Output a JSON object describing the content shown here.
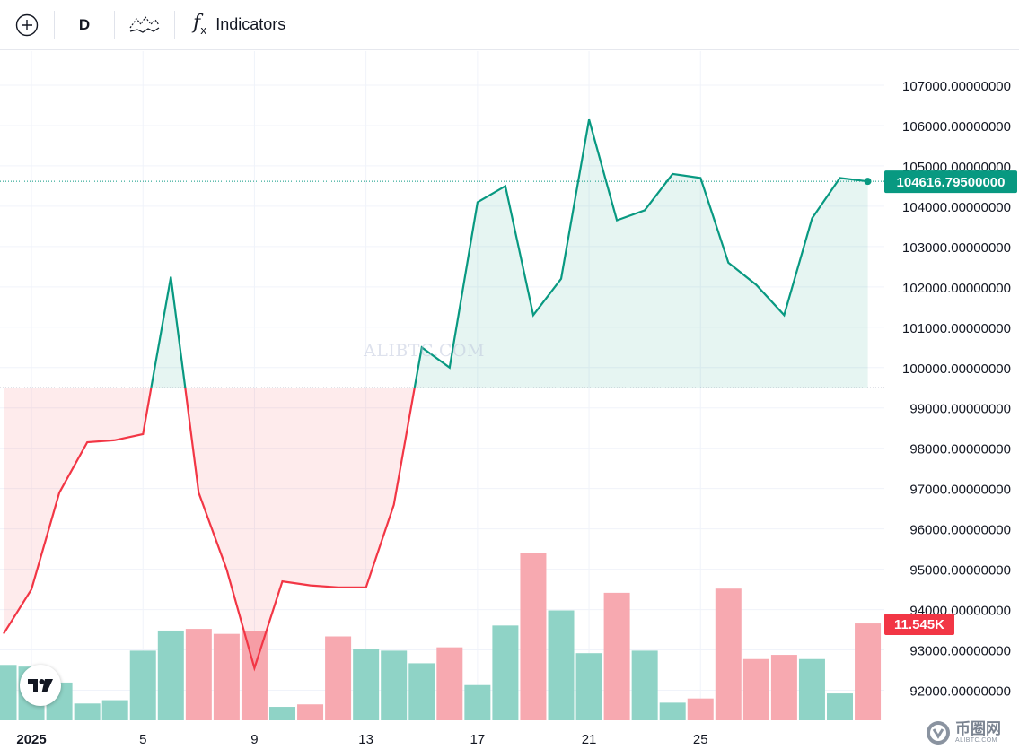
{
  "toolbar": {
    "add_icon": "plus-circle-icon",
    "interval_label": "D",
    "compare_icon": "compare-symbols-icon",
    "indicators_icon": "function-fx-icon",
    "indicators_label": "Indicators"
  },
  "watermark": "ALIBTC.COM",
  "corner_brand": {
    "main": "币圈网",
    "sub": "ALIBTC.COM"
  },
  "colors": {
    "up_line": "#089981",
    "down_line": "#f23645",
    "up_fill": "rgba(8,153,129,0.10)",
    "down_fill": "rgba(242,54,69,0.10)",
    "vol_up": "#8fd3c6",
    "vol_down": "#f7a9b0",
    "last_price_tag": "#089981",
    "volume_tag": "#f23645",
    "grid": "#f0f3fa",
    "axis_text": "#131722"
  },
  "chart_data": {
    "type": "area",
    "series_style": "baseline",
    "interval": "D",
    "baseline": 99500,
    "ylim": [
      91700,
      107600
    ],
    "y_ticks": [
      92000,
      93000,
      94000,
      95000,
      96000,
      97000,
      98000,
      99000,
      100000,
      101000,
      102000,
      103000,
      104000,
      105000,
      106000,
      107000
    ],
    "y_tick_labels": [
      "92000.00000000",
      "93000.00000000",
      "94000.00000000",
      "95000.00000000",
      "96000.00000000",
      "97000.00000000",
      "98000.00000000",
      "99000.00000000",
      "100000.00000000",
      "101000.00000000",
      "102000.00000000",
      "103000.00000000",
      "104000.00000000",
      "105000.00000000",
      "106000.00000000",
      "107000.00000000"
    ],
    "x_ticks": [
      {
        "day": 1,
        "label": "2025"
      },
      {
        "day": 5,
        "label": "5"
      },
      {
        "day": 9,
        "label": "9"
      },
      {
        "day": 13,
        "label": "13"
      },
      {
        "day": 17,
        "label": "17"
      },
      {
        "day": 21,
        "label": "21"
      },
      {
        "day": 25,
        "label": "25"
      }
    ],
    "days": [
      0,
      1,
      2,
      3,
      4,
      5,
      6,
      7,
      8,
      9,
      10,
      11,
      12,
      13,
      14,
      15,
      16,
      17,
      18,
      19,
      20,
      21,
      22,
      23,
      24,
      25,
      26,
      27,
      28,
      29,
      30,
      31
    ],
    "values": [
      93400,
      94500,
      96900,
      98150,
      98200,
      98350,
      102250,
      96900,
      95000,
      92550,
      94700,
      94600,
      94550,
      94550,
      96600,
      100500,
      100000,
      104100,
      104500,
      101300,
      102200,
      106150,
      103650,
      103900,
      104800,
      104700,
      102600,
      102050,
      101300,
      103700,
      104700,
      104616.795
    ],
    "last_value": 104616.795,
    "last_value_label": "104616.79500000",
    "grid": true,
    "volume": {
      "values": [
        6.6,
        6.4,
        4.5,
        2.0,
        2.4,
        8.3,
        10.7,
        10.9,
        10.3,
        10.6,
        1.6,
        1.9,
        10.0,
        8.5,
        8.3,
        6.8,
        8.7,
        4.2,
        11.3,
        20.0,
        13.1,
        8.0,
        15.2,
        8.3,
        2.1,
        2.6,
        15.7,
        7.3,
        7.8,
        7.3,
        3.2,
        11.545
      ],
      "directions": [
        "up",
        "up",
        "up",
        "up",
        "up",
        "up",
        "up",
        "down",
        "down",
        "down",
        "up",
        "down",
        "down",
        "up",
        "up",
        "up",
        "down",
        "up",
        "up",
        "down",
        "up",
        "up",
        "down",
        "up",
        "up",
        "down",
        "down",
        "down",
        "down",
        "up",
        "up",
        "down"
      ],
      "last_label": "11.545K"
    }
  }
}
